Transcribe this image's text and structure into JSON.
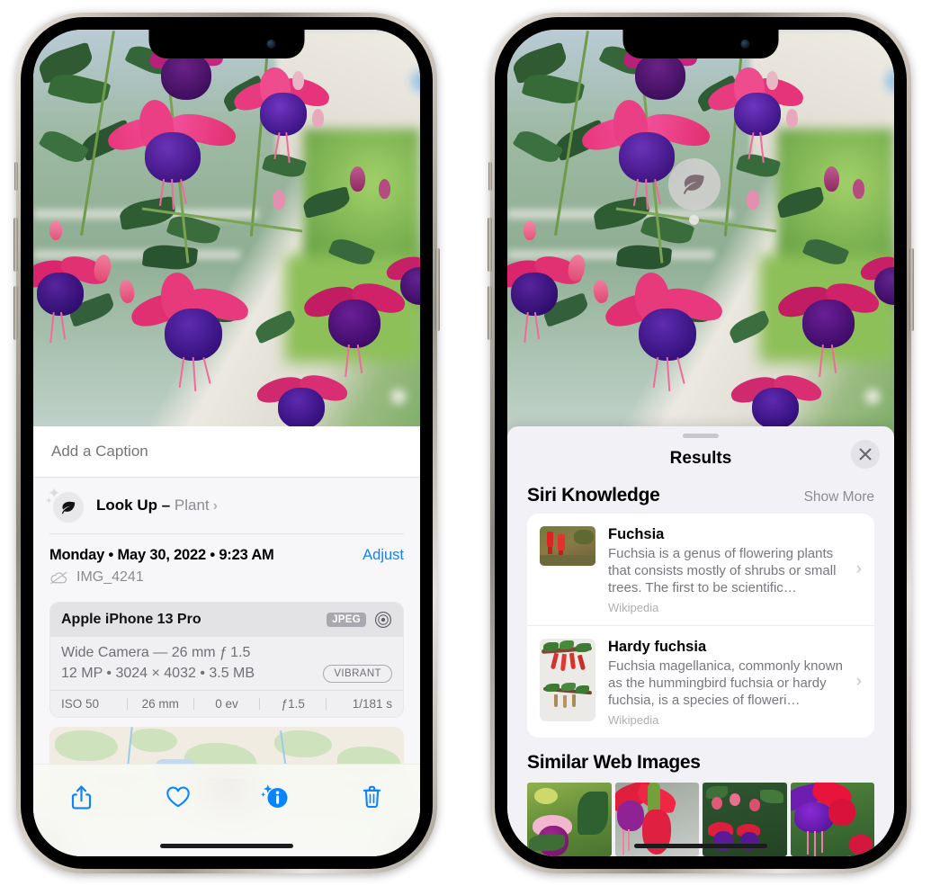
{
  "left_phone": {
    "caption": {
      "placeholder": "Add a Caption",
      "value": ""
    },
    "lookup": {
      "label": "Look Up – ",
      "subject": "Plant",
      "chevron": "›",
      "icon": "leaf-icon"
    },
    "meta": {
      "date": "Monday • May 30, 2022 • 9:23 AM",
      "adjust_label": "Adjust",
      "filename": "IMG_4241",
      "cloud_icon": "icloud-slash-icon"
    },
    "exif": {
      "device": "Apple iPhone 13 Pro",
      "format_badge": "JPEG",
      "raw_icon": "aperture-icon",
      "lens_line": "Wide Camera — 26 mm ƒ 1.5",
      "size_line": "12 MP • 3024 × 4032 • 3.5 MB",
      "style_badge": "VIBRANT",
      "stats": [
        "ISO 50",
        "26 mm",
        "0 ev",
        "ƒ1.5",
        "1/181 s"
      ]
    },
    "toolbar": [
      {
        "name": "share-button",
        "icon": "share-icon"
      },
      {
        "name": "favorite-button",
        "icon": "heart-icon"
      },
      {
        "name": "info-button",
        "icon": "info-sparkle-icon"
      },
      {
        "name": "delete-button",
        "icon": "trash-icon"
      }
    ]
  },
  "right_phone": {
    "badge": {
      "icon": "leaf-icon"
    },
    "sheet": {
      "title": "Results",
      "close_icon": "close-icon"
    },
    "siri_knowledge": {
      "title": "Siri Knowledge",
      "show_more": "Show More",
      "items": [
        {
          "title": "Fuchsia",
          "description": "Fuchsia is a genus of flowering plants that consists mostly of shrubs or small trees. The first to be scientific…",
          "source": "Wikipedia",
          "chevron": "›"
        },
        {
          "title": "Hardy fuchsia",
          "description": "Fuchsia magellanica, commonly known as the hummingbird fuchsia or hardy fuchsia, is a species of floweri…",
          "source": "Wikipedia",
          "chevron": "›"
        }
      ]
    },
    "similar_web_images": {
      "title": "Similar Web Images",
      "tiles": [
        "fuchsia-pink-white",
        "fuchsia-red-magenta",
        "fuchsia-bush-buds",
        "fuchsia-purple-red"
      ]
    }
  },
  "colors": {
    "accent_blue": "#0a84ff",
    "sheet_bg": "#f2f1f6",
    "info_bg": "#f7f7f9",
    "card_bg": "#ffffff",
    "secondary_text": "#8c8c92"
  }
}
